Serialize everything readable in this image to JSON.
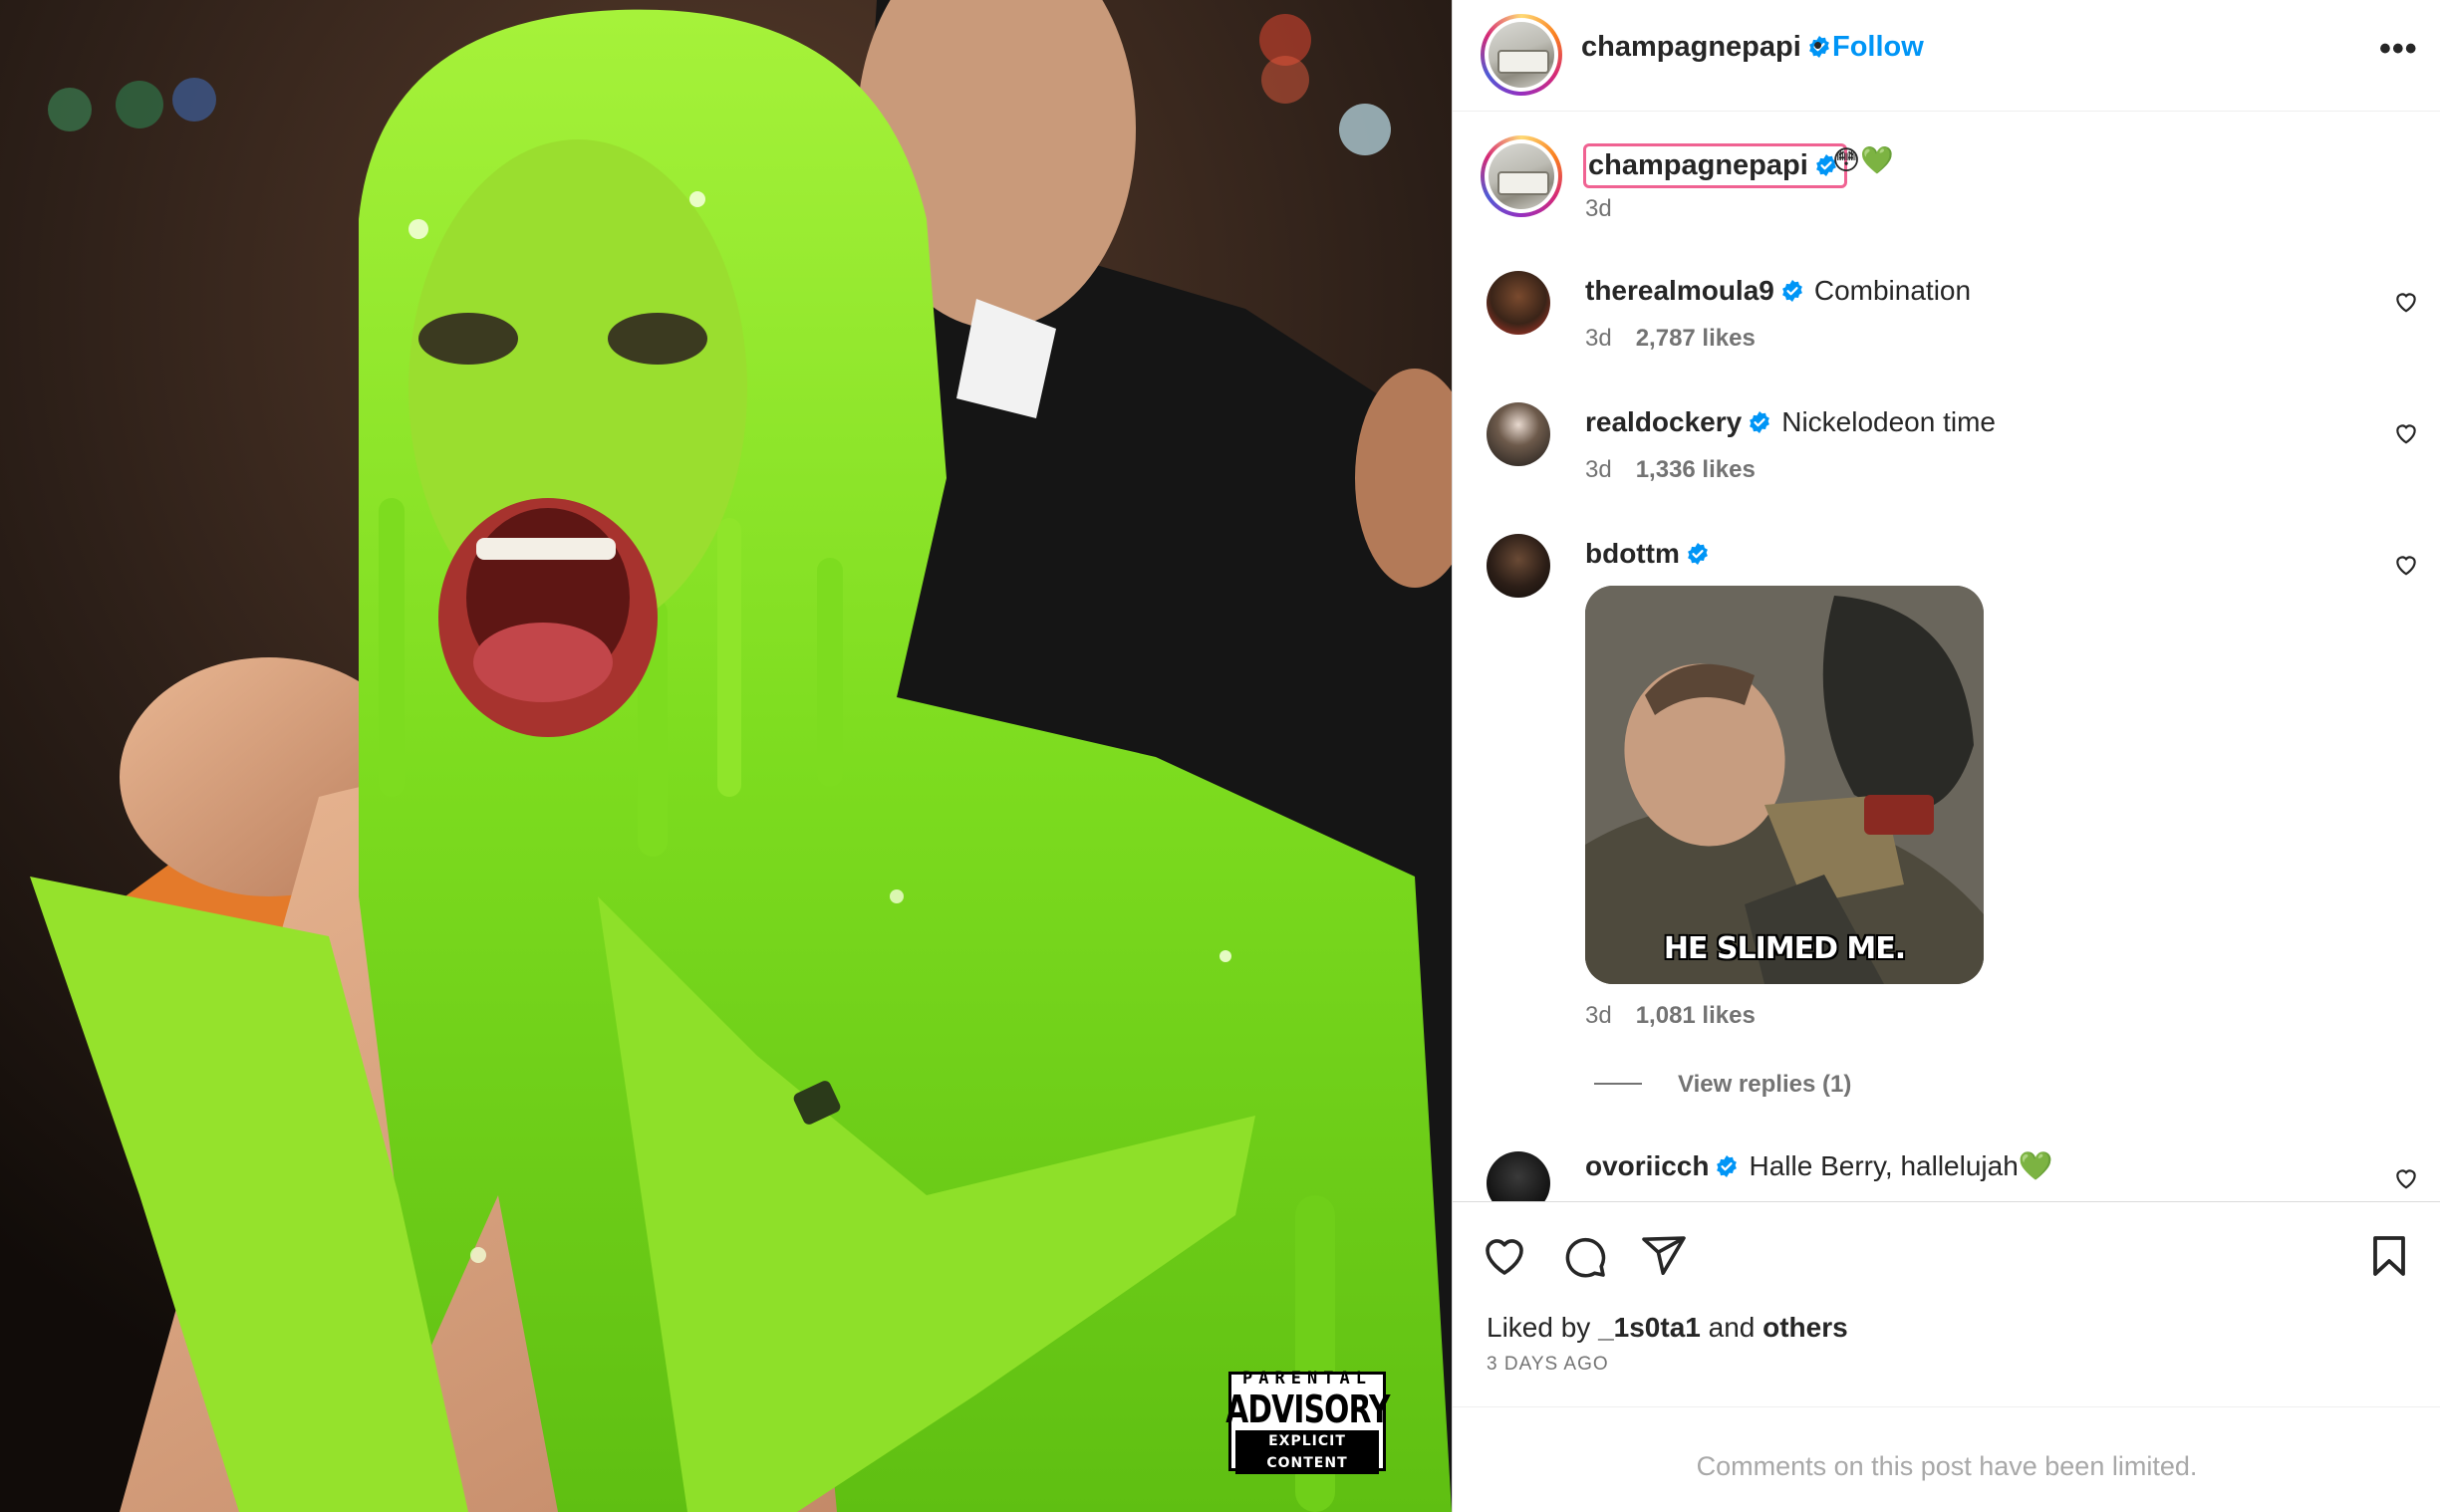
{
  "post": {
    "author": "champagnepapi",
    "follow_label": "Follow",
    "separator": "•",
    "more_label": "•••",
    "caption_emoji": "😳💚",
    "caption_time": "3d"
  },
  "comments": [
    {
      "user": "therealmoula9",
      "text": "Combination",
      "time": "3d",
      "likes": "2,787 likes"
    },
    {
      "user": "realdockery",
      "text": "Nickelodeon time",
      "time": "3d",
      "likes": "1,336 likes"
    },
    {
      "user": "bdottm",
      "text": "",
      "time": "3d",
      "likes": "1,081 likes",
      "gif_caption": "HE SLIMED ME.",
      "view_replies": "View replies (1)"
    },
    {
      "user": "ovoriicch",
      "text": "Halle Berry, hallelujah💚"
    }
  ],
  "actions": {
    "liked_prefix": "Liked by",
    "liked_user": "_1s0ta1",
    "liked_and": "and",
    "liked_others": "others",
    "posted_ago": "3 DAYS AGO"
  },
  "footer": {
    "limited_text": "Comments on this post have been limited."
  },
  "advisory": {
    "line1": "PARENTAL",
    "line2": "ADVISORY",
    "line3": "EXPLICIT CONTENT"
  },
  "colors": {
    "verified_blue": "#0095f6",
    "link_blue": "#0095f6",
    "slime_green": "#7ddc1f",
    "secondary_text": "#737373"
  },
  "icons": [
    "verified-icon",
    "heart-icon",
    "comment-icon",
    "share-icon",
    "bookmark-icon",
    "more-icon"
  ]
}
